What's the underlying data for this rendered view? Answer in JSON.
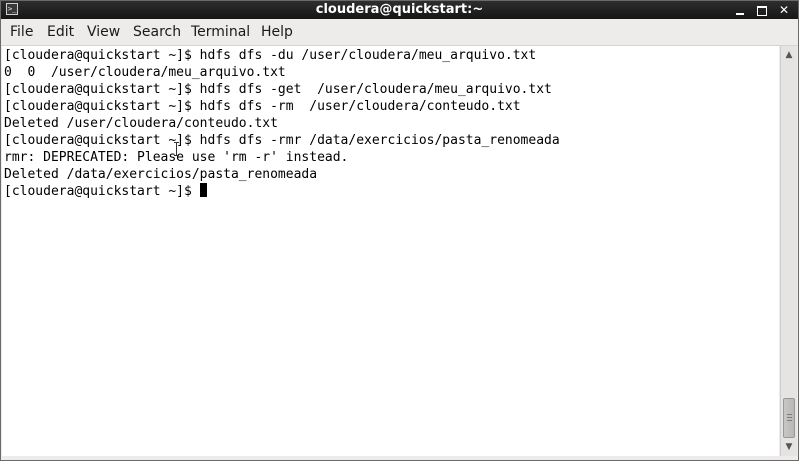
{
  "window": {
    "title": "cloudera@quickstart:~",
    "app_icon": "terminal-icon",
    "controls": {
      "minimize_icon": "minimize-icon",
      "maximize_icon": "maximize-icon",
      "close_glyph": "✕"
    }
  },
  "menu": {
    "file": "File",
    "edit": "Edit",
    "view": "View",
    "search": "Search",
    "terminal": "Terminal",
    "help": "Help"
  },
  "terminal": {
    "lines": [
      "[cloudera@quickstart ~]$ hdfs dfs -du /user/cloudera/meu_arquivo.txt",
      "0  0  /user/cloudera/meu_arquivo.txt",
      "[cloudera@quickstart ~]$ hdfs dfs -get  /user/cloudera/meu_arquivo.txt",
      "[cloudera@quickstart ~]$ hdfs dfs -rm  /user/cloudera/conteudo.txt",
      "Deleted /user/cloudera/conteudo.txt",
      "[cloudera@quickstart ~]$ hdfs dfs -rmr /data/exercicios/pasta_renomeada",
      "rmr: DEPRECATED: Please use 'rm -r' instead.",
      "Deleted /data/exercicios/pasta_renomeada"
    ],
    "prompt": "[cloudera@quickstart ~]$ "
  },
  "scrollbar": {
    "up_arrow": "▲",
    "down_arrow": "▼"
  },
  "colors": {
    "titlebar": "#1f1f1f",
    "terminal_bg": "#ffffff",
    "terminal_fg": "#000000",
    "chrome": "#edeceb"
  }
}
